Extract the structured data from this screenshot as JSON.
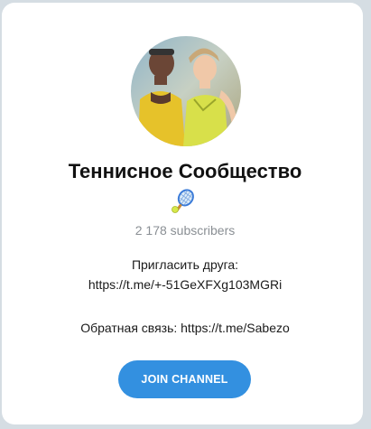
{
  "channel": {
    "title": "Теннисное Сообщество",
    "emoji_icon": "tennis-racket-icon",
    "subscribers": "2 178 subscribers",
    "description": {
      "invite_label": "Пригласить друга:",
      "invite_link": "https://t.me/+-51GeXFXg103MGRi",
      "feedback": "Обратная связь: https://t.me/Sabezo"
    }
  },
  "actions": {
    "join_label": "JOIN CHANNEL"
  },
  "colors": {
    "accent": "#3390e0",
    "background": "#d5dde3",
    "card": "#ffffff",
    "muted_text": "#8a8f94"
  }
}
